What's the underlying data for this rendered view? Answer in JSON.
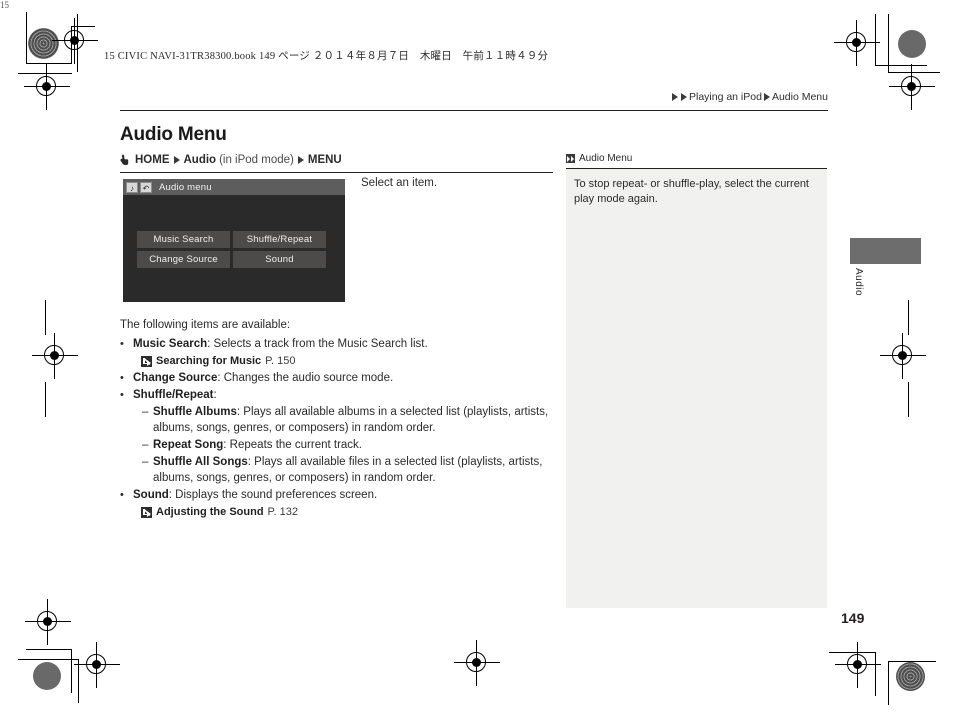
{
  "print_marks": {
    "corner_label": "15"
  },
  "header": {
    "book_line": "15 CIVIC NAVI-31TR38300.book  149 ページ  ２０１４年８月７日　木曜日　午前１１時４９分"
  },
  "breadcrumb": {
    "item1": "Playing an iPod",
    "item2": "Audio Menu"
  },
  "page": {
    "title": "Audio Menu",
    "number": "149"
  },
  "command_path": {
    "home_label": "HOME",
    "audio_label": "Audio",
    "mode_note": "(in iPod mode)",
    "menu_label": "MENU"
  },
  "nav_screen": {
    "title": "Audio menu",
    "title_icons": [
      "music-note-icon",
      "return-arrow-icon"
    ],
    "buttons": [
      "Music Search",
      "Shuffle/Repeat",
      "Change Source",
      "Sound"
    ]
  },
  "instruction": {
    "text": "Select an item."
  },
  "body": {
    "intro": "The following items are available:",
    "bullet_mark": "•",
    "dash_mark": "–",
    "items": [
      {
        "term": "Music Search",
        "desc": ": Selects a track from the Music Search list.",
        "reference": {
          "title": "Searching for Music",
          "page": "P. 150"
        }
      },
      {
        "term": "Change Source",
        "desc": ": Changes the audio source mode."
      },
      {
        "term": "Shuffle/Repeat",
        "desc": ":",
        "sub_items": [
          {
            "term": "Shuffle Albums",
            "desc": ": Plays all available albums in a selected list (playlists, artists, albums, songs, genres, or composers) in random order."
          },
          {
            "term": "Repeat Song",
            "desc": ": Repeats the current track."
          },
          {
            "term": "Shuffle All Songs",
            "desc": ": Plays all available files in a selected list (playlists, artists, albums, songs, genres, or composers) in random order."
          }
        ]
      },
      {
        "term": "Sound",
        "desc": ": Displays the sound preferences screen.",
        "reference": {
          "title": "Adjusting the Sound",
          "page": "P. 132"
        }
      }
    ]
  },
  "side_note": {
    "heading": "Audio Menu",
    "text": "To stop repeat- or shuffle-play, select the current play mode again."
  },
  "side_tab": {
    "label": "Audio"
  },
  "colors": {
    "nav_screen_bg": "#2a2a2a",
    "nav_titlebar": "#5d5d5d",
    "nav_button": "#4d4a4a",
    "note_box_bg": "#f1f1f0",
    "side_tab": "#6d6d6d"
  }
}
